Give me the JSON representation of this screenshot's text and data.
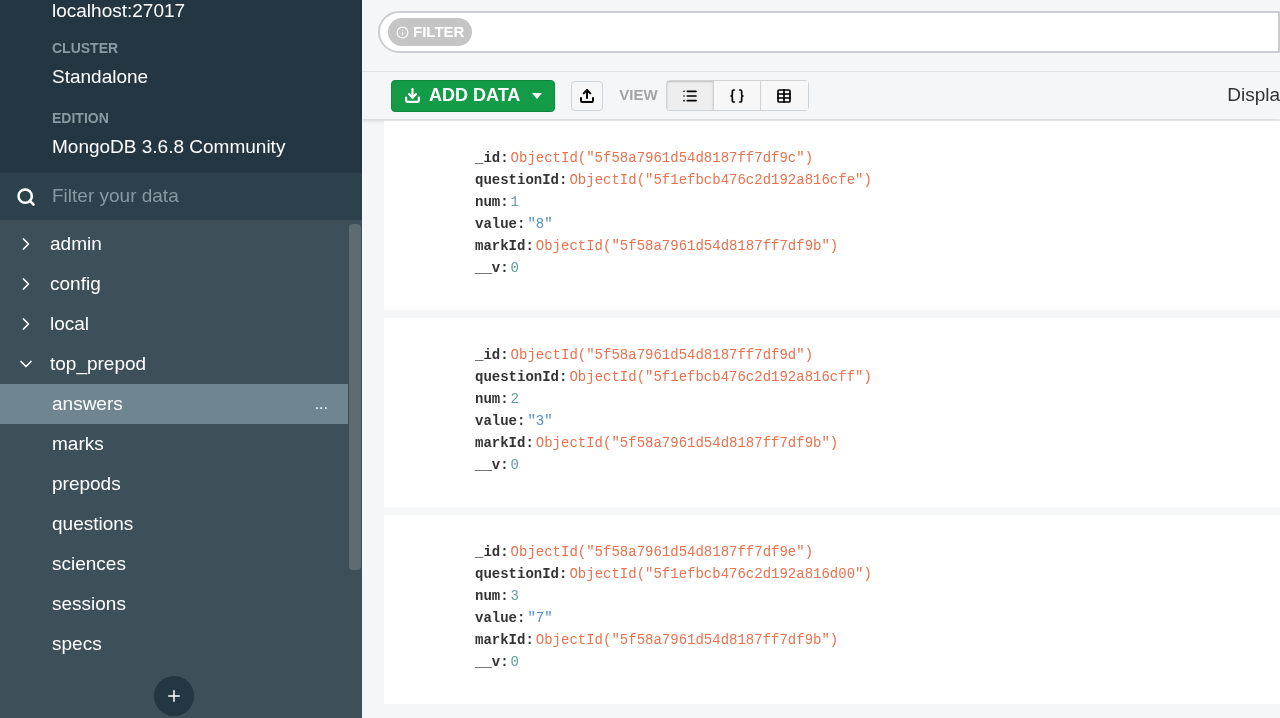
{
  "sidebar": {
    "host": "localhost:27017",
    "info": [
      {
        "label": "CLUSTER",
        "value": "Standalone"
      },
      {
        "label": "EDITION",
        "value": "MongoDB 3.6.8 Community"
      }
    ],
    "search": {
      "placeholder": "Filter your data"
    },
    "databases": [
      {
        "name": "admin",
        "expanded": false
      },
      {
        "name": "config",
        "expanded": false
      },
      {
        "name": "local",
        "expanded": false
      },
      {
        "name": "top_prepod",
        "expanded": true,
        "children": [
          {
            "name": "answers",
            "selected": true,
            "more": "..."
          },
          {
            "name": "marks",
            "selected": false
          },
          {
            "name": "prepods",
            "selected": false
          },
          {
            "name": "questions",
            "selected": false
          },
          {
            "name": "sciences",
            "selected": false
          },
          {
            "name": "sessions",
            "selected": false
          },
          {
            "name": "specs",
            "selected": false
          }
        ]
      }
    ]
  },
  "filter": {
    "label": "FILTER"
  },
  "toolbar": {
    "add_data": "ADD DATA",
    "view_label": "VIEW",
    "views": [
      {
        "kind": "list",
        "selected": true
      },
      {
        "kind": "json",
        "selected": false
      },
      {
        "kind": "table",
        "selected": false
      }
    ],
    "display": "Displa"
  },
  "documents": [
    {
      "fields": [
        {
          "key": "_id:",
          "kind": "objectid",
          "value": "ObjectId(\"5f58a7961d54d8187ff7df9c\")"
        },
        {
          "key": "questionId:",
          "kind": "objectid",
          "value": "ObjectId(\"5f1efbcb476c2d192a816cfe\")"
        },
        {
          "key": "num:",
          "kind": "number",
          "value": "1"
        },
        {
          "key": "value:",
          "kind": "string",
          "value": "\"8\""
        },
        {
          "key": "markId:",
          "kind": "objectid",
          "value": "ObjectId(\"5f58a7961d54d8187ff7df9b\")"
        },
        {
          "key": "__v:",
          "kind": "number",
          "value": "0"
        }
      ]
    },
    {
      "fields": [
        {
          "key": "_id:",
          "kind": "objectid",
          "value": "ObjectId(\"5f58a7961d54d8187ff7df9d\")"
        },
        {
          "key": "questionId:",
          "kind": "objectid",
          "value": "ObjectId(\"5f1efbcb476c2d192a816cff\")"
        },
        {
          "key": "num:",
          "kind": "number",
          "value": "2"
        },
        {
          "key": "value:",
          "kind": "string",
          "value": "\"3\""
        },
        {
          "key": "markId:",
          "kind": "objectid",
          "value": "ObjectId(\"5f58a7961d54d8187ff7df9b\")"
        },
        {
          "key": "__v:",
          "kind": "number",
          "value": "0"
        }
      ]
    },
    {
      "fields": [
        {
          "key": "_id:",
          "kind": "objectid",
          "value": "ObjectId(\"5f58a7961d54d8187ff7df9e\")"
        },
        {
          "key": "questionId:",
          "kind": "objectid",
          "value": "ObjectId(\"5f1efbcb476c2d192a816d00\")"
        },
        {
          "key": "num:",
          "kind": "number",
          "value": "3"
        },
        {
          "key": "value:",
          "kind": "string",
          "value": "\"7\""
        },
        {
          "key": "markId:",
          "kind": "objectid",
          "value": "ObjectId(\"5f58a7961d54d8187ff7df9b\")"
        },
        {
          "key": "__v:",
          "kind": "number",
          "value": "0"
        }
      ]
    }
  ]
}
